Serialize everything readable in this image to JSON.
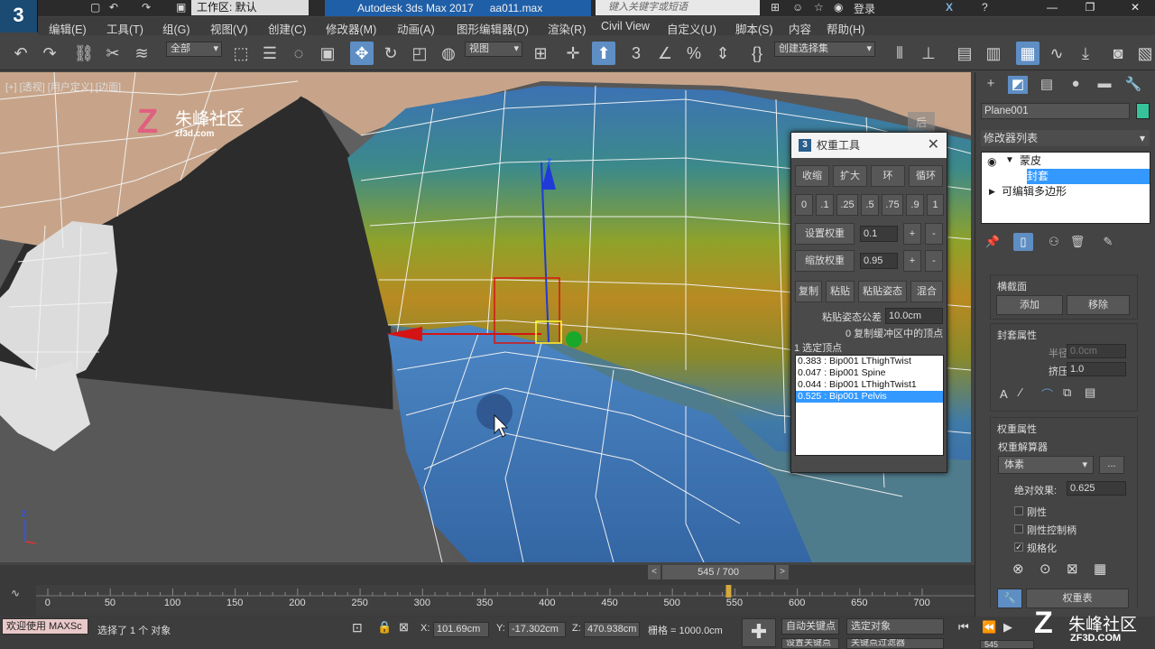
{
  "titlebar": {
    "workspace_label": "工作区: 默认",
    "app_name": "Autodesk 3ds Max 2017",
    "file_name": "aa011.max",
    "search_placeholder": "键入关键字或短语",
    "login": "登录"
  },
  "menu": [
    "编辑(E)",
    "工具(T)",
    "组(G)",
    "视图(V)",
    "创建(C)",
    "修改器(M)",
    "动画(A)",
    "图形编辑器(D)",
    "渲染(R)",
    "Civil View",
    "自定义(U)",
    "脚本(S)",
    "内容",
    "帮助(H)"
  ],
  "toolbar": {
    "filter_value": "全部",
    "ref_coord_value": "视图",
    "selection_set_value": "创建选择集"
  },
  "viewport": {
    "label": "[+] [透视] [用户定义] [边面]",
    "watermark_name": "朱峰社区",
    "watermark_url": "zf3d.com",
    "viewcube_label": "后",
    "gizmo_z_label": "Z"
  },
  "weight_tool": {
    "title": "权重工具",
    "buttons_row1": [
      "收缩",
      "扩大",
      "环",
      "循环"
    ],
    "presets": [
      "0",
      ".1",
      ".25",
      ".5",
      ".75",
      ".9",
      "1"
    ],
    "set_weight_label": "设置权重",
    "set_weight_value": "0.1",
    "scale_weight_label": "缩放权重",
    "scale_weight_value": "0.95",
    "plus": "+",
    "minus": "-",
    "buttons_row2": [
      "复制",
      "粘贴",
      "粘贴姿态",
      "混合"
    ],
    "paste_tolerance_label": "粘贴姿态公差",
    "paste_tolerance_value": "10.0cm",
    "buffer_info": "0 复制缓冲区中的顶点",
    "selected_info": "1 选定顶点",
    "list": [
      "0.383 : Bip001 LThighTwist",
      "0.047 : Bip001 Spine",
      "0.044 : Bip001 LThighTwist1",
      "0.525 : Bip001 Pelvis"
    ],
    "selected_index": 3
  },
  "command_panel": {
    "object_name": "Plane001",
    "object_color": "#36c39a",
    "modifier_list": "修改器列表",
    "stack": [
      "蒙皮",
      "封套",
      "可编辑多边形"
    ],
    "cross_section": {
      "title": "横截面",
      "add": "添加",
      "remove": "移除"
    },
    "envelope_props": {
      "title": "封套属性",
      "radius_label": "半径:",
      "radius_value": "0.0cm",
      "squash_label": "挤压:",
      "squash_value": "1.0",
      "icon_a": "A"
    },
    "weight_props": {
      "title": "权重属性",
      "solver_label": "权重解算器",
      "solver_value": "体素",
      "more": "...",
      "abs_effect_label": "绝对效果:",
      "abs_effect_value": "0.625",
      "rigid": "刚性",
      "rigid_handles": "刚性控制柄",
      "normalize": "规格化",
      "weight_table": "权重表"
    }
  },
  "timeline": {
    "frame_display": "545 / 700",
    "current_frame": 545,
    "ticks": [
      "0",
      "50",
      "100",
      "150",
      "200",
      "250",
      "300",
      "350",
      "400",
      "450",
      "500",
      "550",
      "600",
      "650",
      "700"
    ]
  },
  "statusbar": {
    "maxscript": "欢迎使用 MAXSc",
    "selected": "选择了 1 个 对象",
    "x_label": "X:",
    "x_value": "101.69cm",
    "y_label": "Y:",
    "y_value": "-17.302cm",
    "z_label": "Z:",
    "z_value": "470.938cm",
    "grid": "栅格 = 1000.0cm",
    "auto_key": "自动关键点",
    "selected_obj": "选定对象",
    "set_key": "设置关键点",
    "key_filters": "关键点过滤器",
    "frame_field": "545",
    "bottom_watermark": "朱峰社区",
    "bottom_url": "ZF3D.COM"
  }
}
